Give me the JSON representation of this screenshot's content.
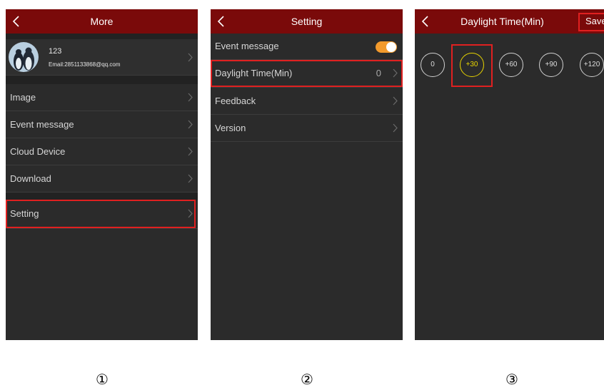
{
  "screen1": {
    "title": "More",
    "profile": {
      "name": "123",
      "email": "Email:2851133868@qq.com"
    },
    "menu": [
      "Image",
      "Event message",
      "Cloud Device",
      "Download"
    ],
    "setting": "Setting"
  },
  "screen2": {
    "title": "Setting",
    "rows": {
      "event": "Event message",
      "daylight": "Daylight Time(Min)",
      "daylight_value": "0",
      "feedback": "Feedback",
      "version": "Version"
    },
    "event_toggle_on": true
  },
  "screen3": {
    "title": "Daylight Time(Min)",
    "save": "Save",
    "options": [
      "0",
      "+30",
      "+60",
      "+90",
      "+120"
    ],
    "selected": "+30"
  },
  "step_numbers": [
    "①",
    "②",
    "③"
  ],
  "colors": {
    "header": "#7a0a0a",
    "background": "#2b2b2b",
    "highlight": "#e02020",
    "toggle": "#f29a2c",
    "selected": "#e8d400"
  }
}
